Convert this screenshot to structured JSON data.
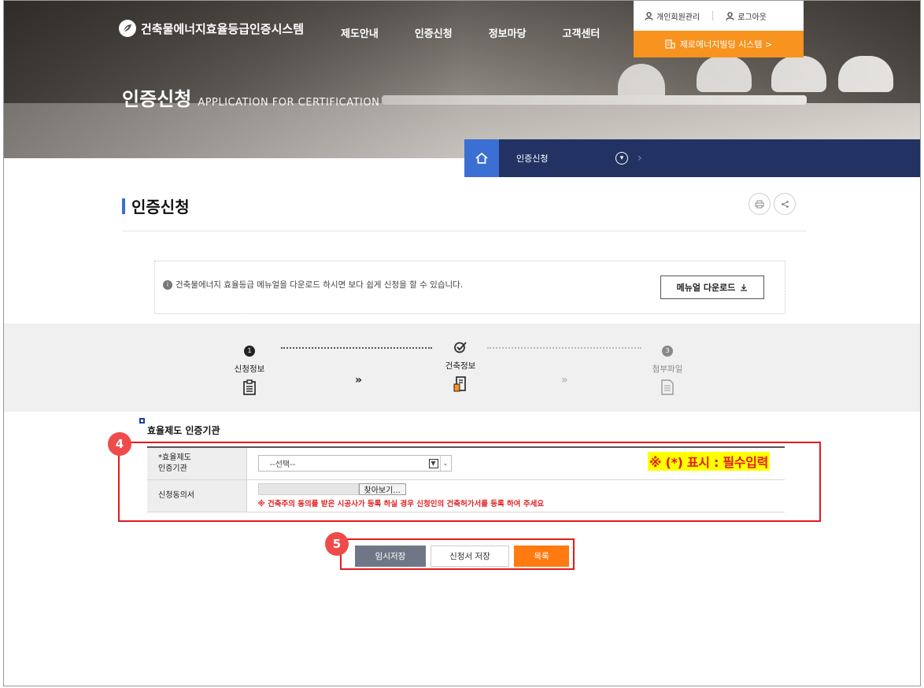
{
  "header": {
    "logo_text": "건축물에너지효율등급인증시스템",
    "nav": [
      "제도안내",
      "인증신청",
      "정보마당",
      "고객센터"
    ],
    "util_links": [
      "개인회원관리",
      "로그아웃"
    ],
    "zeb_button": "제로에너지빌딩 시스템  >",
    "hero_title_ko": "인증신청",
    "hero_title_en": "APPLICATION FOR CERTIFICATION"
  },
  "location": {
    "current": "인증신청"
  },
  "page": {
    "title": "인증신청"
  },
  "notice": {
    "text": "건축물에너지 효율등급 메뉴얼을 다운로드 하시면 보다 쉽게 신청을 할 수 있습니다.",
    "download_button": "메뉴얼 다운로드"
  },
  "steps": [
    {
      "number": "1",
      "label": "신청정보"
    },
    {
      "number": "",
      "label": "건축정보"
    },
    {
      "number": "3",
      "label": "첨부파일"
    }
  ],
  "step_arrow": "»",
  "section": {
    "title": "효율제도 인증기관",
    "rows": {
      "org_label_1": "*효율제도",
      "org_label_2": "인증기관",
      "org_select_value": "--선택--",
      "consent_label": "신청동의서",
      "browse_button": "찾아보기...",
      "consent_warning": "※ 건축주의 동의를 받은 시공사가 등록 하실 경우 신청인의 건축허가서를 등록 하여 주세요"
    },
    "required_note": "※ (*) 표시 : 필수입력"
  },
  "annotations": [
    "4",
    "5"
  ],
  "buttons": {
    "temp_save": "임시저장",
    "save": "신청서 저장",
    "list": "목록"
  },
  "colors": {
    "accent_blue": "#3b6fd3",
    "nav_dark": "#223363",
    "orange": "#f7931e",
    "annotation_red": "#e21b1b"
  }
}
